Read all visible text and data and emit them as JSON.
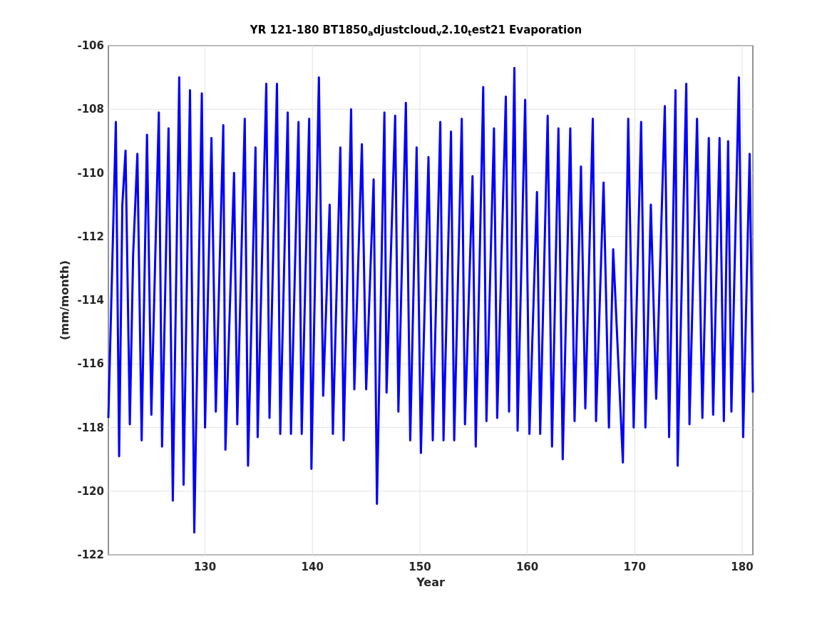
{
  "figure": {
    "chart_data": {
      "type": "line",
      "title": "YR 121-180 BT1850$_{a}$djustcloud$_{v}$2.10$_{t}$est21 Evaporation",
      "xlabel": "Year",
      "ylabel": "(mm/month)",
      "xlim": [
        121,
        181
      ],
      "ylim": [
        -122,
        -106
      ],
      "xticks": [
        130,
        140,
        150,
        160,
        170,
        180
      ],
      "yticks": [
        -122,
        -120,
        -118,
        -116,
        -114,
        -112,
        -110,
        -108,
        -106
      ],
      "x": [
        121.0,
        121.7,
        122.0,
        122.3,
        122.6,
        123.0,
        123.3,
        123.7,
        124.1,
        124.6,
        125.0,
        125.7,
        126.0,
        126.6,
        127.0,
        127.6,
        128.0,
        128.6,
        129.0,
        129.7,
        130.0,
        130.6,
        131.0,
        131.7,
        131.9,
        132.7,
        133.0,
        133.7,
        134.0,
        134.7,
        134.9,
        135.7,
        136.0,
        136.7,
        137.0,
        137.7,
        138.0,
        138.7,
        139.0,
        139.7,
        139.9,
        140.6,
        141.0,
        141.6,
        141.9,
        142.6,
        142.9,
        143.6,
        143.9,
        144.6,
        145.0,
        145.7,
        146.0,
        146.7,
        146.9,
        147.7,
        148.0,
        148.7,
        149.1,
        149.7,
        150.1,
        150.8,
        151.2,
        151.9,
        152.2,
        152.9,
        153.2,
        153.9,
        154.2,
        154.9,
        155.2,
        155.9,
        156.2,
        156.9,
        157.2,
        158.0,
        158.3,
        158.8,
        159.1,
        159.8,
        160.2,
        160.9,
        161.2,
        161.9,
        162.3,
        162.9,
        163.3,
        164.0,
        164.4,
        165.0,
        165.4,
        166.1,
        166.4,
        167.1,
        167.6,
        168.0,
        168.9,
        169.4,
        169.9,
        170.6,
        171.0,
        171.5,
        172.0,
        172.8,
        173.2,
        173.8,
        174.0,
        174.8,
        175.1,
        175.8,
        176.3,
        176.9,
        177.3,
        177.9,
        178.3,
        178.7,
        179.0,
        179.7,
        180.1,
        180.7,
        181.0
      ],
      "grid": true,
      "series": [
        {
          "color": "#0000ff",
          "values": [
            -117.7,
            -108.4,
            -118.9,
            -111,
            -109.3,
            -117.9,
            -112.6,
            -109.4,
            -118.4,
            -108.8,
            -117.6,
            -108.1,
            -118.6,
            -108.6,
            -120.3,
            -107,
            -119.8,
            -107.4,
            -121.3,
            -107.5,
            -118,
            -108.9,
            -117.5,
            -108.5,
            -118.7,
            -110,
            -117.9,
            -108.3,
            -119.2,
            -109.2,
            -118.3,
            -107.2,
            -117.7,
            -107.2,
            -118.2,
            -108.1,
            -118.2,
            -108.4,
            -118.2,
            -108.3,
            -119.3,
            -107,
            -117,
            -111,
            -118.2,
            -109.2,
            -118.4,
            -108,
            -116.8,
            -109.1,
            -116.8,
            -110.2,
            -120.4,
            -108.1,
            -116.9,
            -108.2,
            -117.5,
            -107.8,
            -118.4,
            -109.2,
            -118.8,
            -109.5,
            -118.4,
            -108.4,
            -118.4,
            -108.7,
            -118.4,
            -108.3,
            -117.9,
            -110.1,
            -118.6,
            -107.3,
            -117.8,
            -108.6,
            -117.7,
            -107.6,
            -117.5,
            -106.7,
            -118.1,
            -107.7,
            -118.2,
            -110.6,
            -118.2,
            -108.2,
            -118.6,
            -108.6,
            -119,
            -108.6,
            -117.8,
            -109.8,
            -117.4,
            -108.3,
            -117.8,
            -110.3,
            -118,
            -112.4,
            -119.1,
            -108.3,
            -118,
            -108.4,
            -118,
            -111,
            -117.1,
            -107.9,
            -118.3,
            -107.4,
            -119.2,
            -107.2,
            -117.9,
            -108.3,
            -117.7,
            -108.9,
            -117.6,
            -108.9,
            -117.8,
            -109,
            -117.5,
            -107,
            -118.3,
            -109.4,
            -116.9
          ]
        }
      ]
    }
  }
}
